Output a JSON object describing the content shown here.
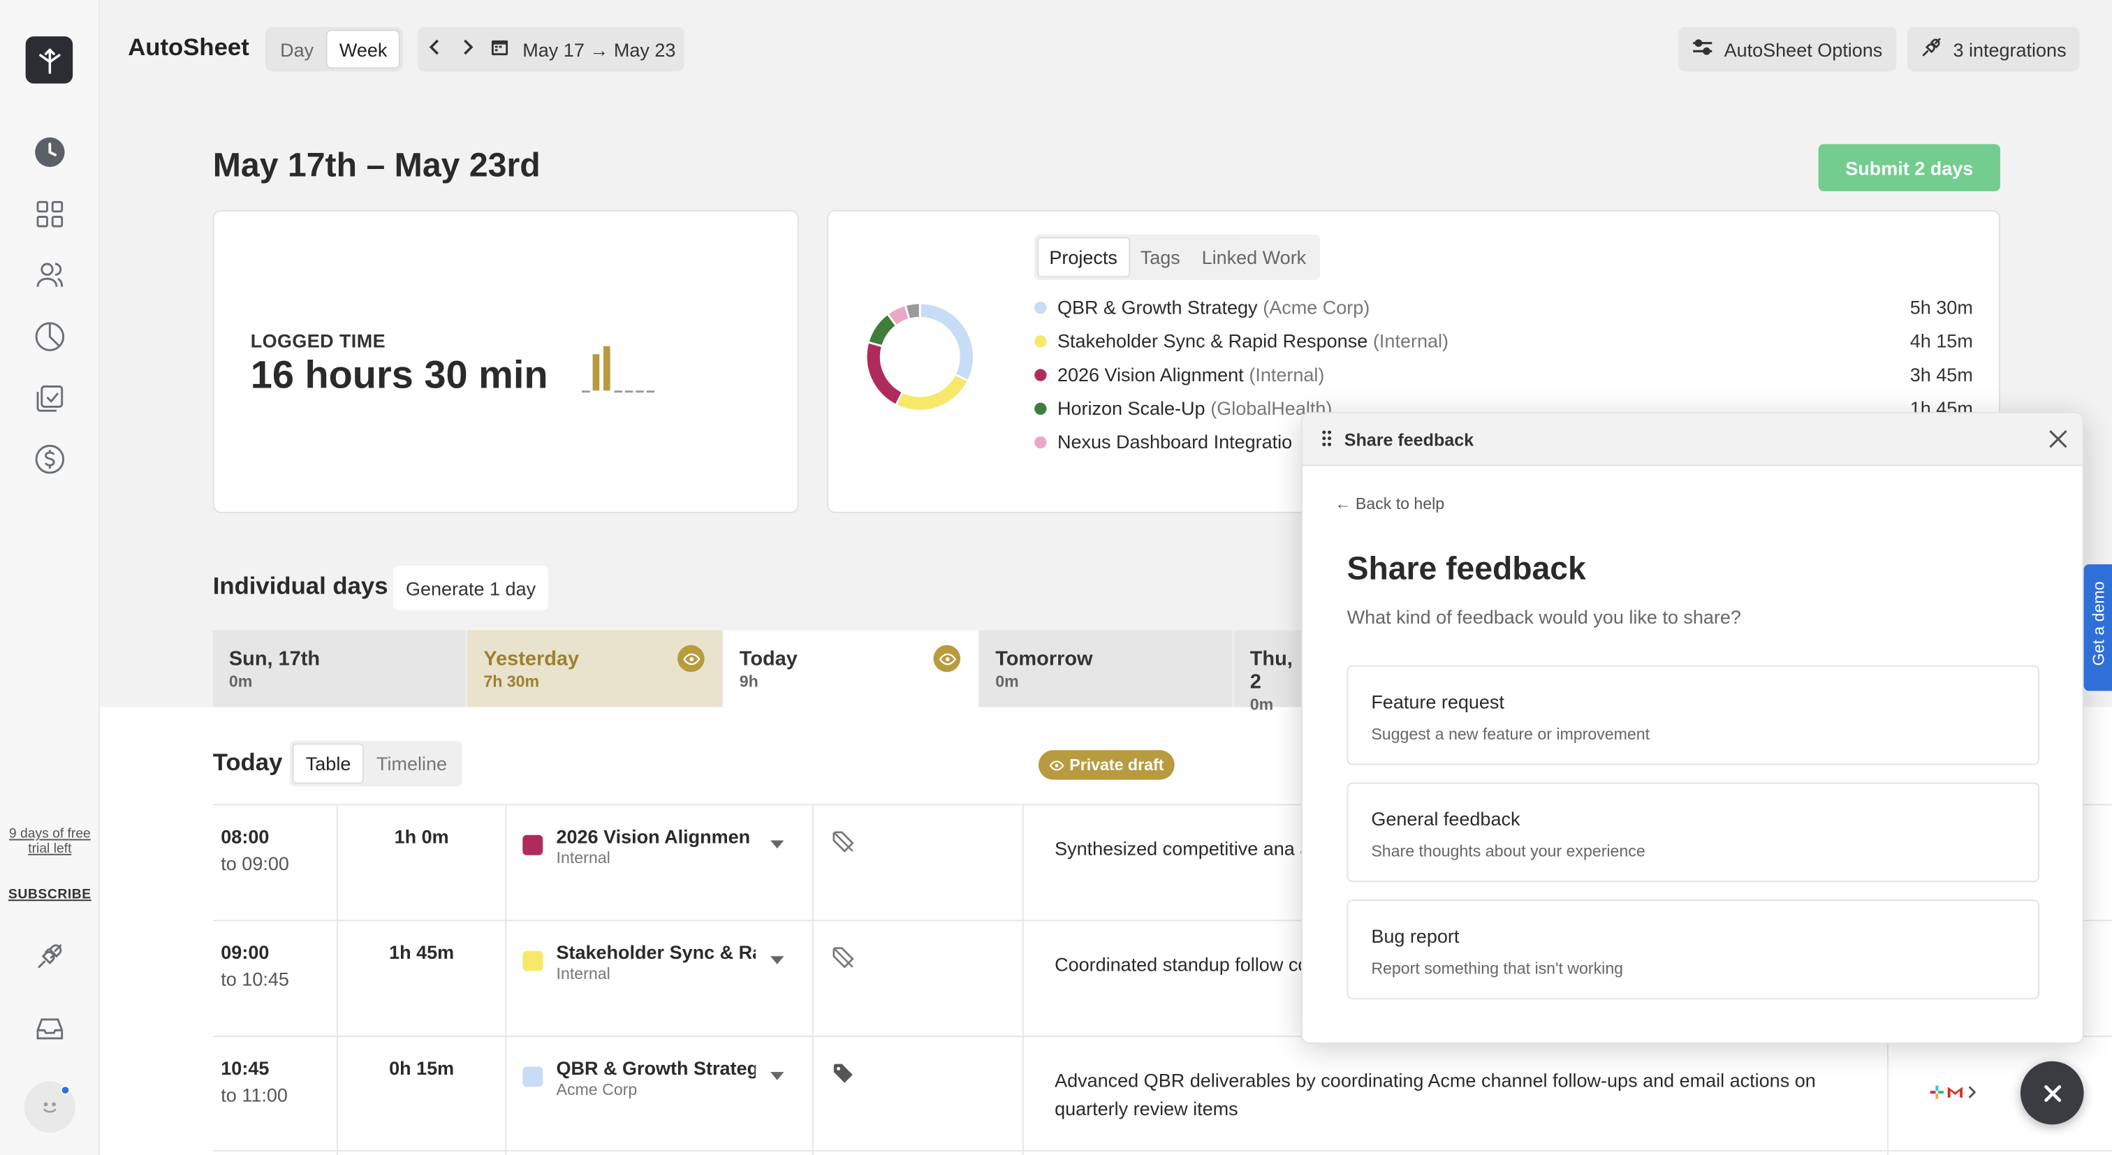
{
  "app": {
    "title": "AutoSheet"
  },
  "header": {
    "view_options": [
      "Day",
      "Week"
    ],
    "active_view": "Week",
    "date_range": "May 17 → May 23",
    "options_label": "AutoSheet Options",
    "integrations_label": "3 integrations"
  },
  "sidebar": {
    "trial_text": "9 days of free trial left",
    "subscribe_label": "SUBSCRIBE"
  },
  "summary": {
    "range_title": "May 17th – May 23rd",
    "submit_label": "Submit 2 days",
    "logged_label": "LOGGED TIME",
    "logged_value": "16 hours 30 min",
    "breakdown_tabs": [
      "Projects",
      "Tags",
      "Linked Work"
    ],
    "active_breakdown": "Projects",
    "projects": [
      {
        "name": "QBR & Growth Strategy",
        "org": "(Acme Corp)",
        "hours": "5h 30m",
        "color": "#c7dcf5"
      },
      {
        "name": "Stakeholder Sync & Rapid Response",
        "org": "(Internal)",
        "hours": "4h 15m",
        "color": "#f6e96a"
      },
      {
        "name": "2026 Vision Alignment",
        "org": "(Internal)",
        "hours": "3h 45m",
        "color": "#b02b5c"
      },
      {
        "name": "Horizon Scale-Up",
        "org": "(GlobalHealth)",
        "hours": "1h 45m",
        "color": "#3f7d3a"
      },
      {
        "name": "Nexus Dashboard Integratio",
        "org": "",
        "hours": "",
        "color": "#e8a9c8"
      }
    ]
  },
  "days": {
    "title": "Individual days",
    "generate_label": "Generate 1 day",
    "items": [
      {
        "name": "Sun, 17th",
        "hours": "0m"
      },
      {
        "name": "Yesterday",
        "hours": "7h 30m"
      },
      {
        "name": "Today",
        "hours": "9h"
      },
      {
        "name": "Tomorrow",
        "hours": "0m"
      },
      {
        "name": "Thu, 2",
        "hours": "0m"
      }
    ]
  },
  "today": {
    "title": "Today",
    "view_tabs": [
      "Table",
      "Timeline"
    ],
    "active_tab": "Table",
    "draft_label": "Private draft",
    "entries": [
      {
        "start": "08:00",
        "end": "to 09:00",
        "duration": "1h 0m",
        "project": "2026 Vision Alignmen",
        "org": "Internal",
        "color": "#b02b5c",
        "description": "Synthesized competitive ana and hiring implications",
        "tagged": false
      },
      {
        "start": "09:00",
        "end": "to 10:45",
        "duration": "1h 45m",
        "project": "Stakeholder Sync & Ra",
        "org": "Internal",
        "color": "#f6e96a",
        "description": "Coordinated standup follow communications to keep sta",
        "tagged": false
      },
      {
        "start": "10:45",
        "end": "to 11:00",
        "duration": "0h 15m",
        "project": "QBR & Growth Strateg",
        "org": "Acme Corp",
        "color": "#c7dcf5",
        "description": "Advanced QBR deliverables by coordinating Acme channel follow-ups and email actions on quarterly review items",
        "tagged": true
      }
    ]
  },
  "feedback": {
    "header_title": "Share feedback",
    "back_label": "← Back to help",
    "title": "Share feedback",
    "subtitle": "What kind of feedback would you like to share?",
    "options": [
      {
        "title": "Feature request",
        "desc": "Suggest a new feature or improvement"
      },
      {
        "title": "General feedback",
        "desc": "Share thoughts about your experience"
      },
      {
        "title": "Bug report",
        "desc": "Report something that isn't working"
      }
    ]
  },
  "demo_label": "Get a demo",
  "colors": {
    "accent_gold": "#b89b3e",
    "submit_green": "#73cd8f",
    "demo_blue": "#2f6fd8"
  }
}
